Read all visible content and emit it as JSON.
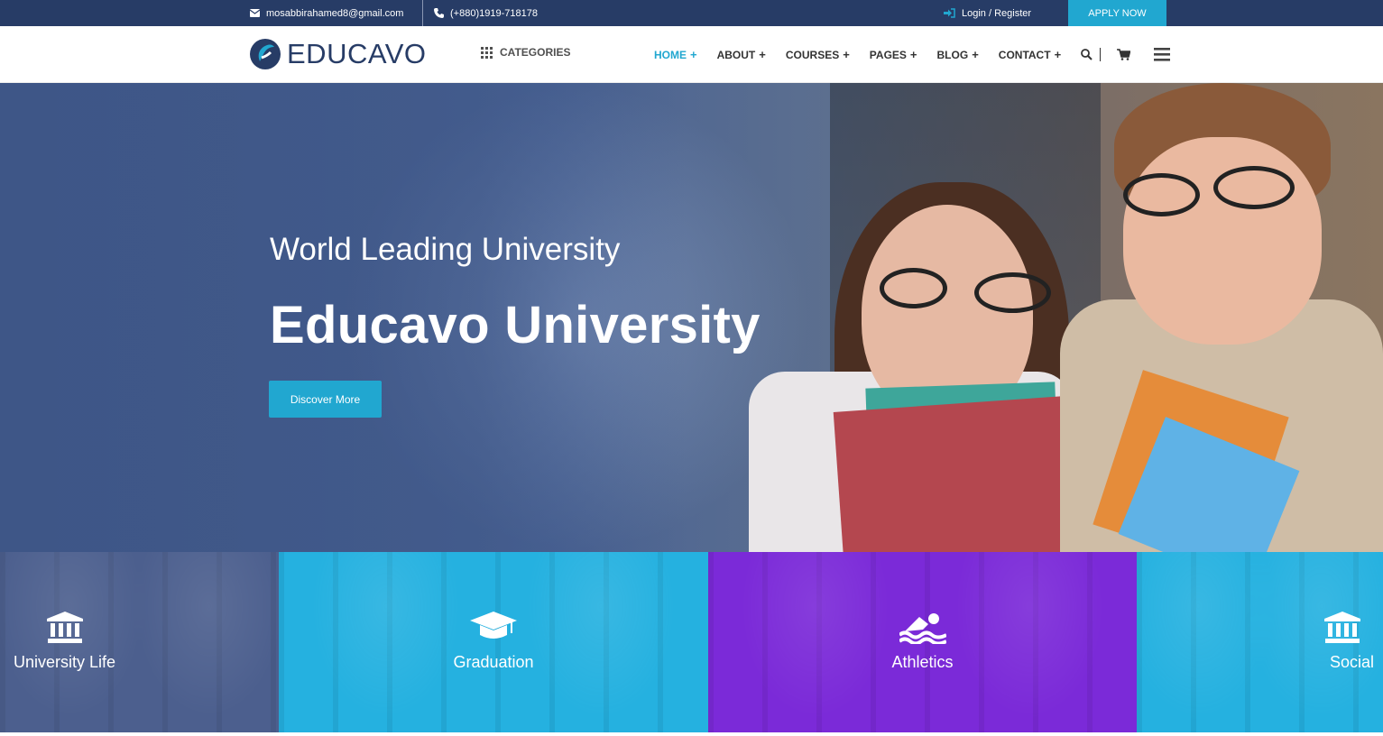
{
  "topbar": {
    "email": "mosabbirahamed8@gmail.com",
    "phone": "(+880)1919-718178",
    "login": "Login / Register",
    "apply": "APPLY NOW"
  },
  "header": {
    "logo_text": "EDUCAVO",
    "categories": "CATEGORIES",
    "nav": [
      {
        "label": "HOME",
        "active": true
      },
      {
        "label": "ABOUT"
      },
      {
        "label": "COURSES"
      },
      {
        "label": "PAGES"
      },
      {
        "label": "BLOG"
      },
      {
        "label": "CONTACT"
      }
    ],
    "plus": "+"
  },
  "hero": {
    "subtitle": "World Leading University",
    "title": "Educavo University",
    "cta": "Discover More"
  },
  "features": [
    {
      "label": "University Life",
      "icon": "university-icon"
    },
    {
      "label": "Graduation",
      "icon": "graduation-cap-icon"
    },
    {
      "label": "Athletics",
      "icon": "swimmer-icon"
    },
    {
      "label": "Social",
      "icon": "university-icon"
    }
  ],
  "colors": {
    "topbar_bg": "#273c66",
    "accent": "#21a7d0",
    "tile_blue": "#25b1e0",
    "tile_purple": "#7b2ad8",
    "tile_navy": "#4c5f8e"
  }
}
